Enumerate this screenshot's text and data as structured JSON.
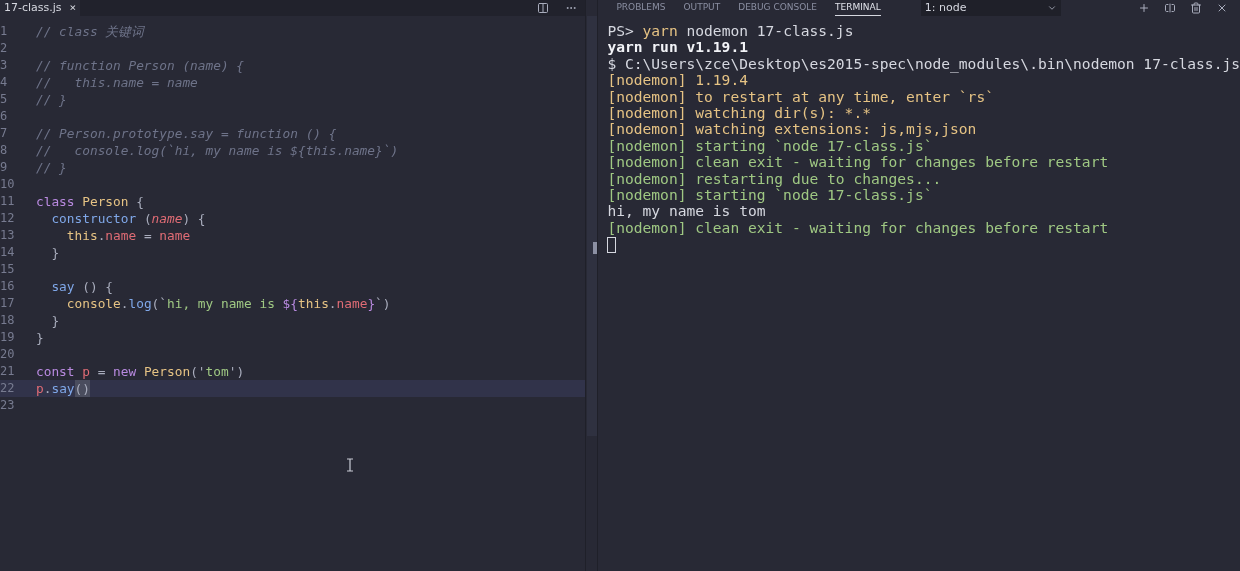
{
  "editor": {
    "tab": {
      "label": "17-class.js",
      "close": "×"
    },
    "lines": [
      {
        "number": "1",
        "current": false,
        "tokens": [
          {
            "text": "// class 关键词",
            "kind": "comment"
          }
        ]
      },
      {
        "number": "2",
        "current": false
      },
      {
        "number": "3",
        "current": false,
        "tokens": [
          {
            "text": "// function Person (name) {",
            "kind": "comment"
          }
        ]
      },
      {
        "number": "4",
        "current": false,
        "tokens": [
          {
            "text": "//   this.name = name",
            "kind": "comment"
          }
        ]
      },
      {
        "number": "5",
        "current": false,
        "tokens": [
          {
            "text": "// }",
            "kind": "comment"
          }
        ]
      },
      {
        "number": "6",
        "current": false
      },
      {
        "number": "7",
        "current": false,
        "tokens": [
          {
            "text": "// Person.prototype.say = function () {",
            "kind": "comment"
          }
        ]
      },
      {
        "number": "8",
        "current": false,
        "tokens": [
          {
            "text": "//   console.log(`hi, my name is ${this.name}`)",
            "kind": "comment"
          }
        ]
      },
      {
        "number": "9",
        "current": false,
        "tokens": [
          {
            "text": "// }",
            "kind": "comment"
          }
        ]
      },
      {
        "number": "10",
        "current": false
      },
      {
        "number": "11",
        "current": false,
        "tokens": [
          {
            "text": "class ",
            "kind": "keyword"
          },
          {
            "text": "Person",
            "kind": "type"
          },
          {
            "text": " {",
            "kind": "punct"
          }
        ]
      },
      {
        "number": "12",
        "current": false,
        "tokens": [
          {
            "text": "  constructor",
            "kind": "function"
          },
          {
            "text": " (",
            "kind": "punct"
          },
          {
            "text": "name",
            "kind": "param"
          },
          {
            "text": ") {",
            "kind": "punct"
          }
        ]
      },
      {
        "number": "13",
        "current": false,
        "tokens": [
          {
            "text": "    this",
            "kind": "type"
          },
          {
            "text": ".",
            "kind": "punct"
          },
          {
            "text": "name",
            "kind": "property"
          },
          {
            "text": " = ",
            "kind": "punct"
          },
          {
            "text": "name",
            "kind": "property"
          }
        ]
      },
      {
        "number": "14",
        "current": false,
        "tokens": [
          {
            "text": "  }",
            "kind": "punct"
          }
        ]
      },
      {
        "number": "15",
        "current": false
      },
      {
        "number": "16",
        "current": false,
        "tokens": [
          {
            "text": "  say",
            "kind": "function"
          },
          {
            "text": " () {",
            "kind": "punct"
          }
        ]
      },
      {
        "number": "17",
        "current": false,
        "tokens": [
          {
            "text": "    console",
            "kind": "type"
          },
          {
            "text": ".",
            "kind": "punct"
          },
          {
            "text": "log",
            "kind": "function"
          },
          {
            "text": "(`",
            "kind": "punct"
          },
          {
            "text": "hi, my name is ",
            "kind": "string"
          },
          {
            "text": "${",
            "kind": "keyword"
          },
          {
            "text": "this",
            "kind": "type"
          },
          {
            "text": ".",
            "kind": "punct"
          },
          {
            "text": "name",
            "kind": "property"
          },
          {
            "text": "}",
            "kind": "keyword"
          },
          {
            "text": "`)",
            "kind": "punct"
          }
        ]
      },
      {
        "number": "18",
        "current": false,
        "tokens": [
          {
            "text": "  }",
            "kind": "punct"
          }
        ]
      },
      {
        "number": "19",
        "current": false,
        "tokens": [
          {
            "text": "}",
            "kind": "punct"
          }
        ]
      },
      {
        "number": "20",
        "current": false
      },
      {
        "number": "21",
        "current": false,
        "tokens": [
          {
            "text": "const ",
            "kind": "keyword"
          },
          {
            "text": "p",
            "kind": "property"
          },
          {
            "text": " = ",
            "kind": "punct"
          },
          {
            "text": "new ",
            "kind": "keyword"
          },
          {
            "text": "Person",
            "kind": "type"
          },
          {
            "text": "('",
            "kind": "punct"
          },
          {
            "text": "tom",
            "kind": "string"
          },
          {
            "text": "')",
            "kind": "punct"
          }
        ]
      },
      {
        "number": "22",
        "current": true,
        "tokens": [
          {
            "text": "p",
            "kind": "property"
          },
          {
            "text": ".",
            "kind": "punct"
          },
          {
            "text": "say",
            "kind": "function"
          },
          {
            "text": "()",
            "kind": "bracket-match"
          }
        ]
      },
      {
        "number": "23",
        "current": false
      }
    ]
  },
  "panel": {
    "tabs": [
      {
        "label": "PROBLEMS",
        "selected": false
      },
      {
        "label": "OUTPUT",
        "selected": false
      },
      {
        "label": "DEBUG CONSOLE",
        "selected": false
      },
      {
        "label": "TERMINAL",
        "selected": true
      }
    ],
    "terminal_select": "1: node",
    "terminal": [
      {
        "segments": [
          {
            "text": "PS> ",
            "kind": "plain"
          },
          {
            "text": "yarn",
            "kind": "command"
          },
          {
            "text": " nodemon 17-class.js",
            "kind": "plain"
          }
        ]
      },
      {
        "segments": [
          {
            "text": "yarn run v1.19.1",
            "kind": "bold"
          }
        ]
      },
      {
        "segments": [
          {
            "text": "$ C:\\Users\\zce\\Desktop\\es2015-spec\\node_modules\\.bin\\nodemon 17-class.js",
            "kind": "plain"
          }
        ]
      },
      {
        "segments": [
          {
            "text": "[nodemon] 1.19.4",
            "kind": "warn"
          }
        ]
      },
      {
        "segments": [
          {
            "text": "[nodemon] to restart at any time, enter `rs`",
            "kind": "warn"
          }
        ]
      },
      {
        "segments": [
          {
            "text": "[nodemon] watching dir(s): *.*",
            "kind": "warn"
          }
        ]
      },
      {
        "segments": [
          {
            "text": "[nodemon] watching extensions: js,mjs,json",
            "kind": "warn"
          }
        ]
      },
      {
        "segments": [
          {
            "text": "[nodemon] starting `node 17-class.js`",
            "kind": "ok"
          }
        ]
      },
      {
        "segments": [
          {
            "text": "[nodemon] clean exit - waiting for changes before restart",
            "kind": "ok"
          }
        ]
      },
      {
        "segments": [
          {
            "text": "[nodemon] restarting due to changes...",
            "kind": "ok"
          }
        ]
      },
      {
        "segments": [
          {
            "text": "[nodemon] starting `node 17-class.js`",
            "kind": "ok"
          }
        ]
      },
      {
        "segments": [
          {
            "text": "hi, my name is tom",
            "kind": "plain"
          }
        ]
      },
      {
        "segments": [
          {
            "text": "[nodemon] clean exit - waiting for changes before restart",
            "kind": "ok"
          }
        ]
      }
    ]
  }
}
